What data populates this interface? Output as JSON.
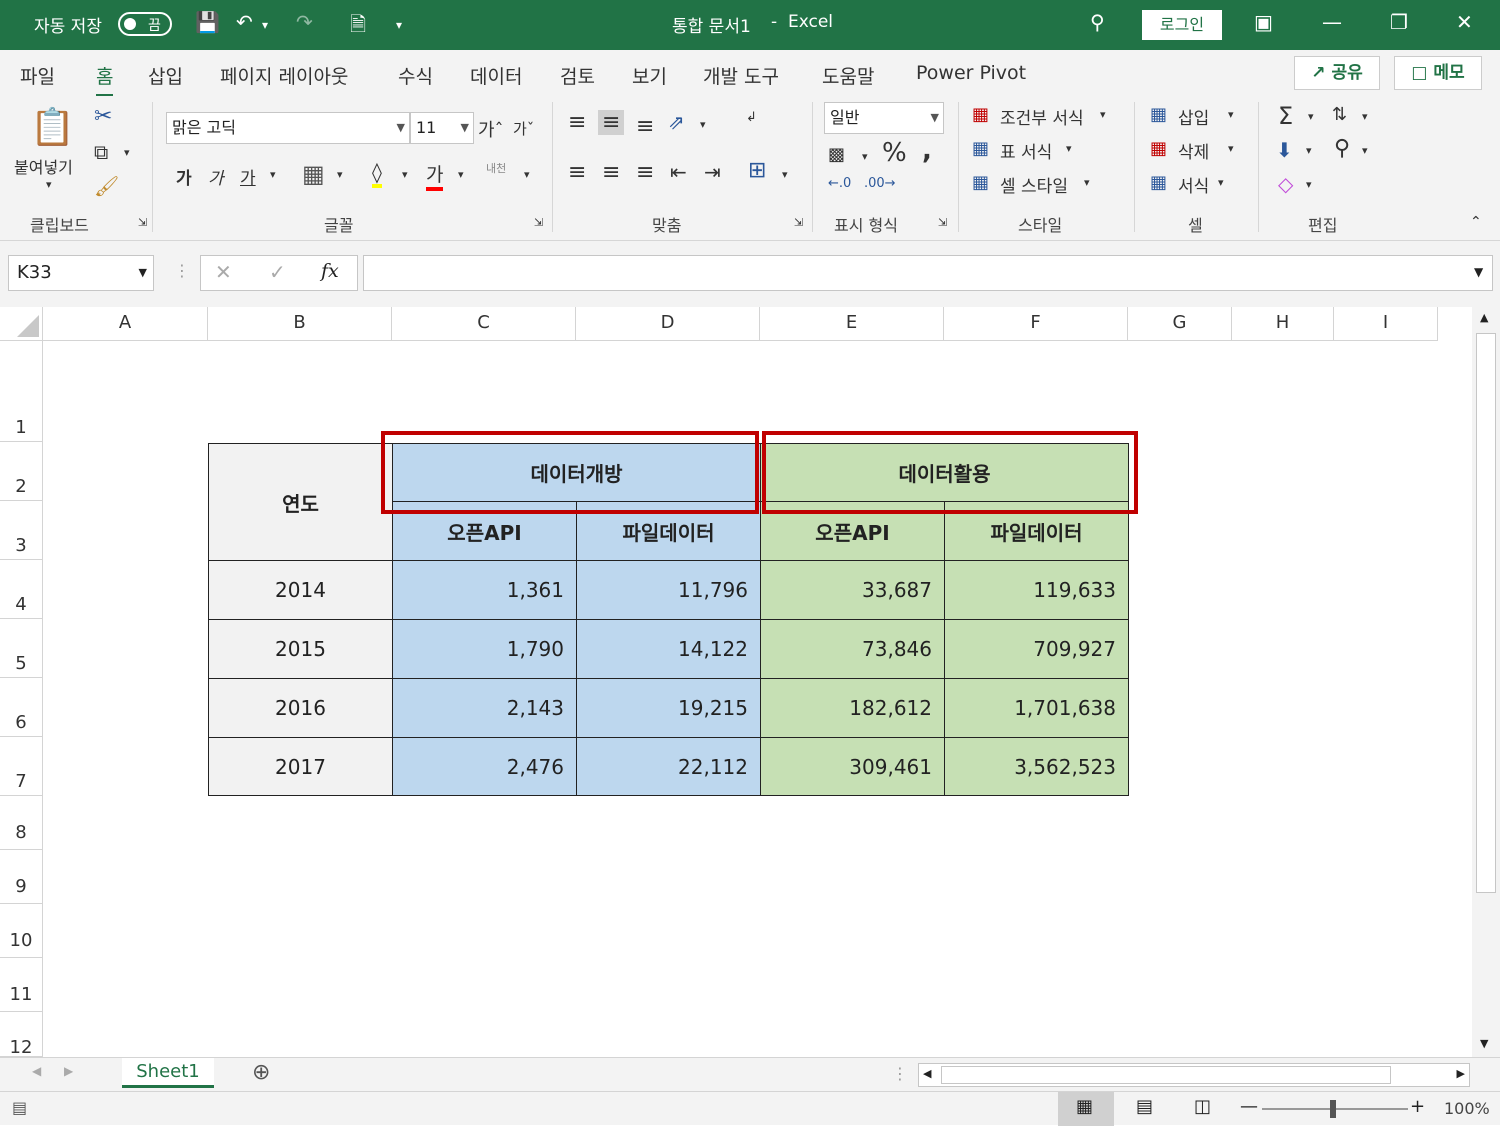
{
  "titlebar": {
    "autosave_label": "자동 저장",
    "autosave_state": "끔",
    "doc_title": "통합 문서1",
    "separator": "-",
    "app_name": "Excel",
    "login_label": "로그인"
  },
  "tabs": [
    "파일",
    "홈",
    "삽입",
    "페이지 레이아웃",
    "수식",
    "데이터",
    "검토",
    "보기",
    "개발 도구",
    "도움말",
    "Power Pivot"
  ],
  "share_label": "공유",
  "memo_label": "메모",
  "ribbon": {
    "paste_label": "붙여넣기",
    "font_name": "맑은 고딕",
    "font_size": "11",
    "number_format": "일반",
    "cond_format": "조건부 서식",
    "table_format": "표 서식",
    "cell_style": "셀 스타일",
    "insert": "삽입",
    "delete": "삭제",
    "format": "서식",
    "groups": [
      "클립보드",
      "글꼴",
      "맞춤",
      "표시 형식",
      "스타일",
      "셀",
      "편집"
    ]
  },
  "formula_bar": {
    "name_box": "K33",
    "fx_label": "fx",
    "formula": ""
  },
  "columns": [
    "A",
    "B",
    "C",
    "D",
    "E",
    "F",
    "G",
    "H",
    "I"
  ],
  "rows": [
    "1",
    "2",
    "3",
    "4",
    "5",
    "6",
    "7",
    "8",
    "9",
    "10",
    "11",
    "12"
  ],
  "table": {
    "year_header": "연도",
    "group_open": "데이터개방",
    "group_use": "데이터활용",
    "sub_headers": [
      "오픈API",
      "파일데이터",
      "오픈API",
      "파일데이터"
    ],
    "data": [
      [
        "2014",
        "1,361",
        "11,796",
        "33,687",
        "119,633"
      ],
      [
        "2015",
        "1,790",
        "14,122",
        "73,846",
        "709,927"
      ],
      [
        "2016",
        "2,143",
        "19,215",
        "182,612",
        "1,701,638"
      ],
      [
        "2017",
        "2,476",
        "22,112",
        "309,461",
        "3,562,523"
      ]
    ]
  },
  "sheet_tab": "Sheet1",
  "zoom": "100%",
  "colors": {
    "excel_green": "#217346",
    "blue_fill": "#bdd7ee",
    "green_fill": "#c6e0b4",
    "highlight": "#c00000"
  }
}
